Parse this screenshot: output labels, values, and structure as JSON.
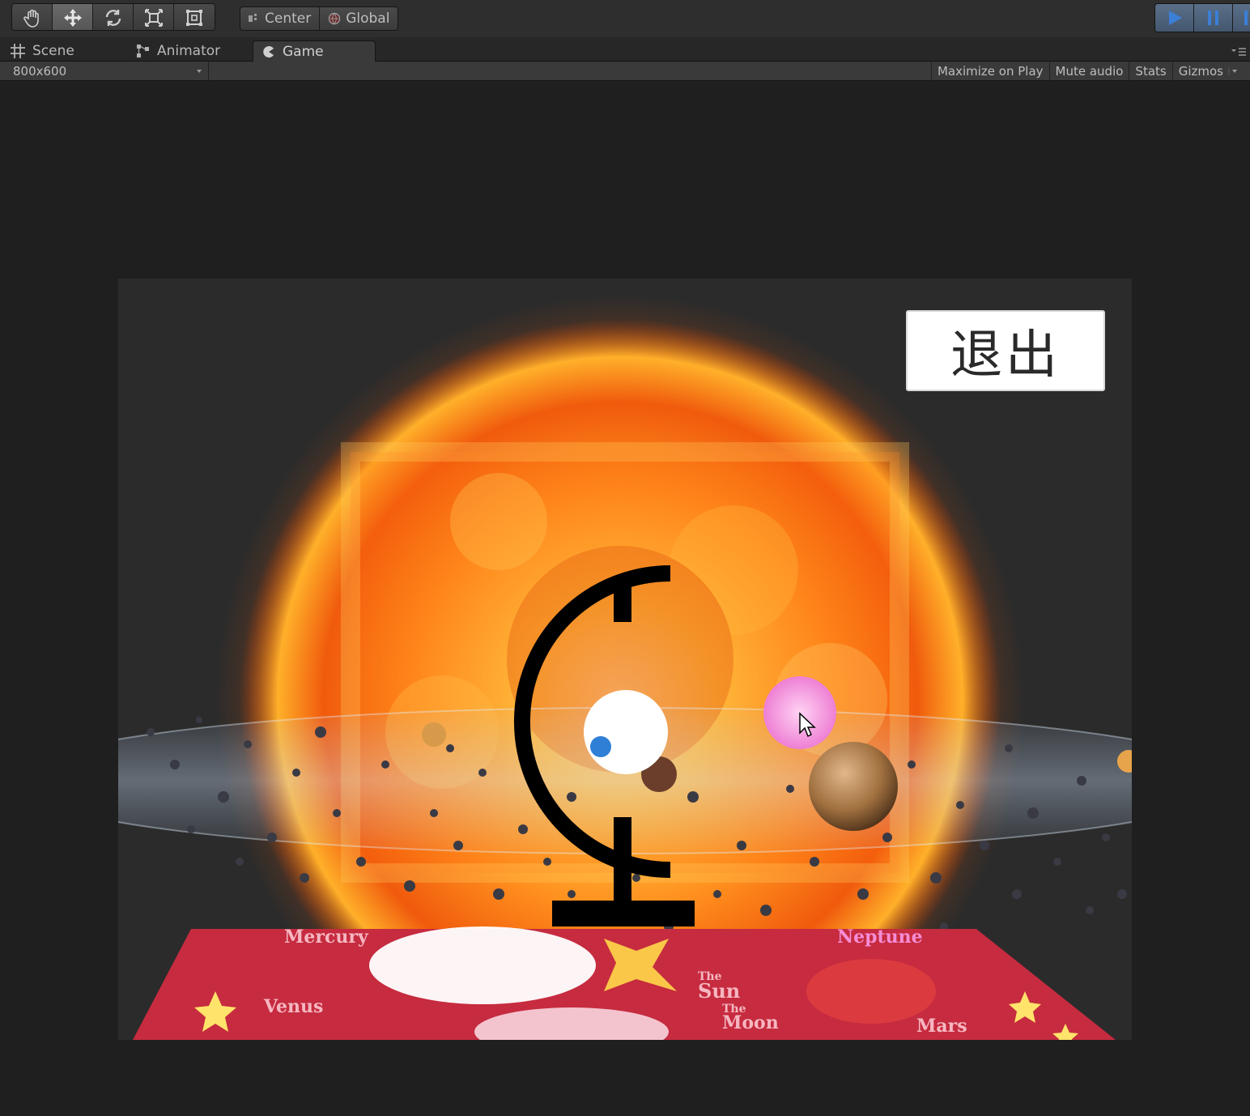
{
  "toolbar": {
    "tools": [
      {
        "name": "hand-tool-icon"
      },
      {
        "name": "move-tool-icon"
      },
      {
        "name": "rotate-tool-icon"
      },
      {
        "name": "scale-tool-icon"
      },
      {
        "name": "rect-tool-icon"
      }
    ],
    "pivot_label": "Center",
    "space_label": "Global"
  },
  "tabs": [
    {
      "label": "Scene",
      "icon": "scene-grid-icon"
    },
    {
      "label": "Animator",
      "icon": "animator-icon"
    },
    {
      "label": "Game",
      "icon": "game-pacman-icon"
    }
  ],
  "gamebar": {
    "resolution": "800x600",
    "maximize": "Maximize on Play",
    "mute": "Mute audio",
    "stats": "Stats",
    "gizmos": "Gizmos"
  },
  "game": {
    "exit_button": "退出",
    "mat_labels": {
      "mercury": "Mercury",
      "neptune": "Neptune",
      "venus": "Venus",
      "sun_1": "The",
      "sun_2": "Sun",
      "moon_1": "The",
      "moon_2": "Moon",
      "mars": "Mars"
    }
  },
  "colors": {
    "accent_play": "#3b7fd6",
    "sun_core": "#ffd54a",
    "sun_edge": "#e23a00",
    "mat": "#c62b3f",
    "pink_orb": "#f59be0"
  }
}
